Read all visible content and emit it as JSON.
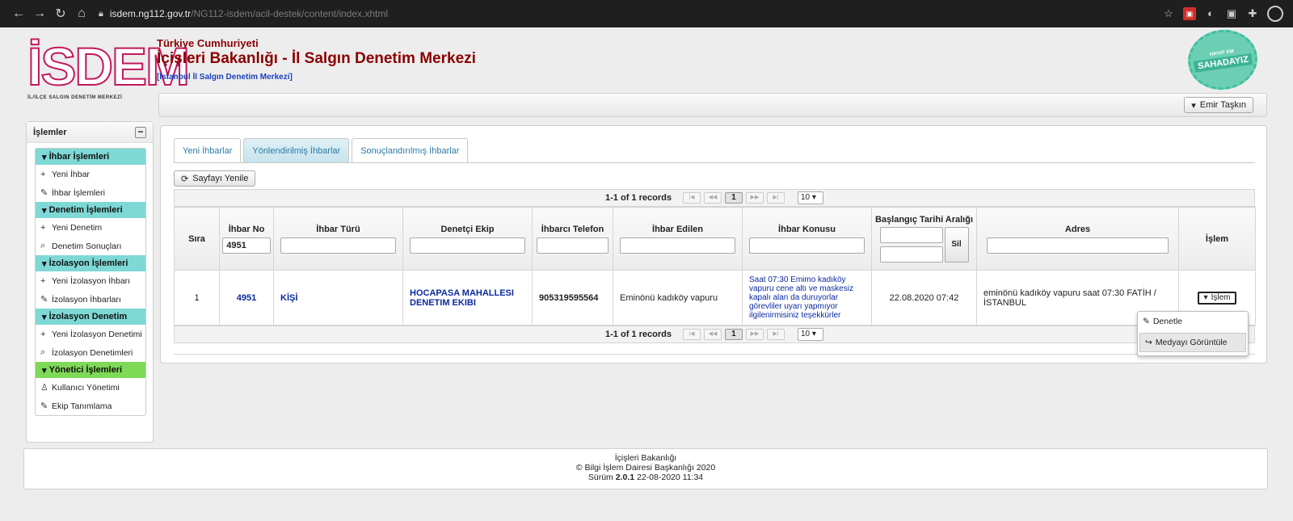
{
  "browser": {
    "url_host": "isdem.ng112.gov.tr",
    "url_path": "/NG112-isdem/acil-destek/content/index.xhtml"
  },
  "header": {
    "logo_text": "İSDEM",
    "logo_subtitle": "İL/İLÇE SALGIN DENETİM MERKEZİ",
    "gov": "Türkiye Cumhuriyeti",
    "title": "İçişleri Bakanlığı - İl Salgın Denetim Merkezi",
    "center": "[İstanbul İl Salgın Denetim Merkezi]",
    "badge_top": "HAYAT KM",
    "badge_main": "SAHADAYIZ",
    "user_button": "Emir Taşkın"
  },
  "sidebar": {
    "title": "İşlemler",
    "groups": [
      {
        "label": "İhbar İşlemleri",
        "items": [
          "Yeni İhbar",
          "İhbar İşlemleri"
        ]
      },
      {
        "label": "Denetim İşlemleri",
        "items": [
          "Yeni Denetim",
          "Denetim Sonuçları"
        ]
      },
      {
        "label": "İzolasyon İşlemleri",
        "items": [
          "Yeni İzolasyon İhbarı",
          "İzolasyon İhbarları"
        ]
      },
      {
        "label": "İzolasyon Denetim",
        "items": [
          "Yeni İzolasyon Denetimi",
          "İzolasyon Denetimleri"
        ]
      },
      {
        "label": "Yönetici İşlemleri",
        "items": [
          "Kullanıcı Yönetimi",
          "Ekip Tanımlama"
        ]
      }
    ]
  },
  "main": {
    "tabs": [
      "Yeni İhbarlar",
      "Yönlendirilmiş İhbarlar",
      "Sonuçlandırılmış İhbarlar"
    ],
    "refresh": "Sayfayı Yenile",
    "records": "1-1 of 1 records",
    "page": "1",
    "per_page": "10",
    "columns": [
      "Sıra",
      "İhbar No",
      "İhbar Türü",
      "Denetçi Ekip",
      "İhbarcı Telefon",
      "İhbar Edilen",
      "İhbar Konusu",
      "Başlangıç Tarihi Aralığı",
      "Adres",
      "İşlem"
    ],
    "filter_ihbar_no": "4951",
    "clear_button": "Sil",
    "row": {
      "sira": "1",
      "ihbar_no": "4951",
      "tur": "KİŞİ",
      "ekip": "HOCAPASA MAHALLESI DENETIM EKIBI",
      "telefon": "905319595564",
      "edilen": "Eminönü kadıköy vapuru",
      "konu": "Saat 07:30 Emimo kadıköy vapuru cene altı ve maskesiz kapalı alan da duruyorlar görevliler uyarı yapmıyor ilgilenirmisiniz teşekkürler",
      "tarih": "22.08.2020 07:42",
      "adres": "eminönü kadıköy vapuru saat 07:30 FATİH / İSTANBUL",
      "islem": "İşlem"
    },
    "dropdown": [
      "Denetle",
      "Medyayı Görüntüle"
    ]
  },
  "footer": {
    "line1": "İçişleri Bakanlığı",
    "line2": "© Bilgi İşlem Dairesi Başkanlığı 2020",
    "version_label": "Sürüm",
    "version": "2.0.1",
    "date": "22-08-2020 11:34"
  }
}
